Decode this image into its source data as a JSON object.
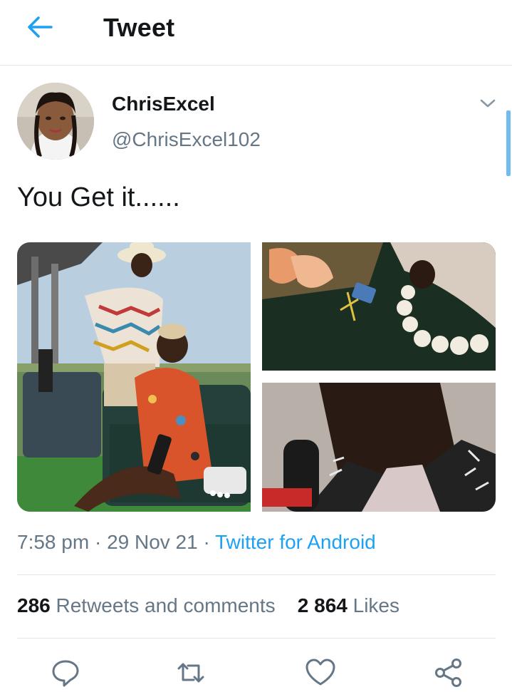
{
  "header": {
    "title": "Tweet",
    "back_icon": "arrow-left-icon",
    "accent_color": "#1da1f2"
  },
  "author": {
    "name": "ChrisExcel",
    "handle": "@ChrisExcel102"
  },
  "tweet": {
    "text": "You Get it......",
    "time": "7:58 pm",
    "date": "29 Nov 21",
    "source": "Twitter for Android",
    "separator": "·"
  },
  "media": [
    {
      "alt": "photo-1"
    },
    {
      "alt": "photo-2"
    },
    {
      "alt": "photo-3"
    }
  ],
  "stats": {
    "retweets_count": "286",
    "retweets_label": "Retweets and comments",
    "likes_count": "2 864",
    "likes_label": "Likes"
  },
  "actions": [
    "reply-icon",
    "retweet-icon",
    "like-icon",
    "share-icon"
  ],
  "colors": {
    "text_secondary": "#657786",
    "divider": "#e1e8ed",
    "link": "#1da1f2"
  }
}
